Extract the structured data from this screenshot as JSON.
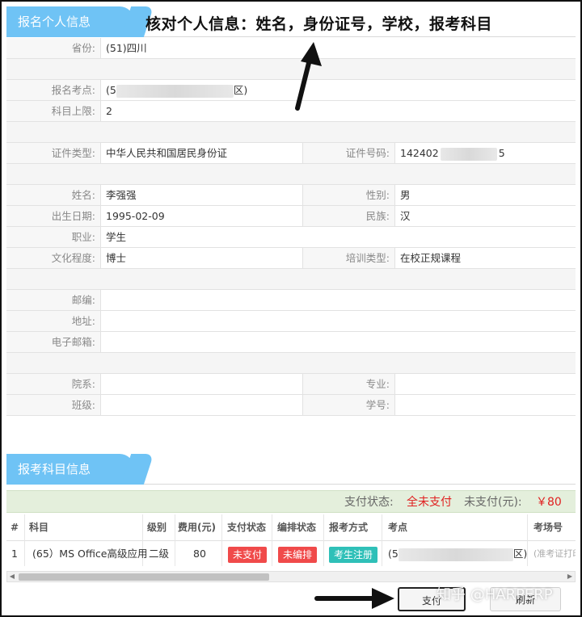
{
  "sections": {
    "personal_title": "报名个人信息",
    "subjects_title": "报考科目信息"
  },
  "annotation": "核对个人信息：姓名，身份证号，学校，报考科目",
  "info": {
    "province_label": "省份:",
    "province_value": "(51)四川",
    "exam_site_label": "报名考点:",
    "exam_site_prefix": "(5",
    "exam_site_suffix": "区)",
    "max_subjects_label": "科目上限:",
    "max_subjects_value": "2",
    "id_type_label": "证件类型:",
    "id_type_value": "中华人民共和国居民身份证",
    "id_number_label": "证件号码:",
    "id_number_prefix": "142402",
    "id_number_suffix": "5",
    "name_label": "姓名:",
    "name_value": "李强强",
    "gender_label": "性别:",
    "gender_value": "男",
    "birth_label": "出生日期:",
    "birth_value": "1995-02-09",
    "ethnicity_label": "民族:",
    "ethnicity_value": "汉",
    "occupation_label": "职业:",
    "occupation_value": "学生",
    "education_label": "文化程度:",
    "education_value": "博士",
    "training_label": "培训类型:",
    "training_value": "在校正规课程",
    "postcode_label": "邮编:",
    "address_label": "地址:",
    "email_label": "电子邮箱:",
    "faculty_label": "院系:",
    "major_label": "专业:",
    "class_label": "班级:",
    "student_id_label": "学号:"
  },
  "payment": {
    "status_label": "支付状态:",
    "status_value": "全未支付",
    "unpaid_label": "未支付(元):",
    "unpaid_value": "￥80"
  },
  "table": {
    "headers": [
      "#",
      "科目",
      "级别",
      "费用(元)",
      "支付状态",
      "编排状态",
      "报考方式",
      "考点",
      "考场号"
    ],
    "row": {
      "index": "1",
      "subject": "(65）MS Office高级应用",
      "level": "二级",
      "fee": "80",
      "pay_status": "未支付",
      "arrange_status": "未编排",
      "method": "考生注册",
      "site_prefix": "(5",
      "site_suffix": "区)",
      "room": "(准考证打印"
    }
  },
  "buttons": {
    "pay": "支付",
    "refresh": "刷新"
  },
  "watermark": "知乎 @HARPERP",
  "colors": {
    "tab_blue": "#6fc3f5",
    "pay_bar_green": "#e4efdc",
    "status_red": "#e02020",
    "badge_red": "#f04a4a",
    "badge_teal": "#2fc0b8"
  }
}
